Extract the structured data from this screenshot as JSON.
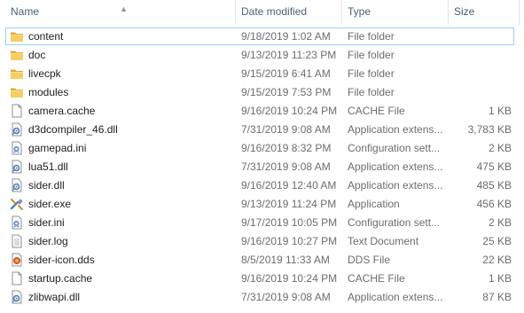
{
  "columns": {
    "name": "Name",
    "date_modified": "Date modified",
    "type": "Type",
    "size": "Size"
  },
  "sort": {
    "column": "name",
    "direction": "ascending"
  },
  "colors": {
    "header_text": "#4c607a",
    "selection_border": "#99d1ff",
    "folder": "#e8b64a",
    "meta_text": "#6d6d6d"
  },
  "files": [
    {
      "name": "content",
      "date": "9/18/2019 1:02 AM",
      "type": "File folder",
      "size": "",
      "icon": "folder-icon",
      "selected": true
    },
    {
      "name": "doc",
      "date": "9/13/2019 11:23 PM",
      "type": "File folder",
      "size": "",
      "icon": "folder-icon"
    },
    {
      "name": "livecpk",
      "date": "9/15/2019 6:41 AM",
      "type": "File folder",
      "size": "",
      "icon": "folder-icon"
    },
    {
      "name": "modules",
      "date": "9/15/2019 7:53 PM",
      "type": "File folder",
      "size": "",
      "icon": "folder-icon"
    },
    {
      "name": "camera.cache",
      "date": "9/16/2019 10:24 PM",
      "type": "CACHE File",
      "size": "1 KB",
      "icon": "blank-file-icon"
    },
    {
      "name": "d3dcompiler_46.dll",
      "date": "7/31/2019 9:08 AM",
      "type": "Application extens...",
      "size": "3,783 KB",
      "icon": "dll-file-icon"
    },
    {
      "name": "gamepad.ini",
      "date": "9/16/2019 8:32 PM",
      "type": "Configuration sett...",
      "size": "2 KB",
      "icon": "settings-file-icon"
    },
    {
      "name": "lua51.dll",
      "date": "7/31/2019 9:08 AM",
      "type": "Application extens...",
      "size": "475 KB",
      "icon": "dll-file-icon"
    },
    {
      "name": "sider.dll",
      "date": "9/16/2019 12:40 AM",
      "type": "Application extens...",
      "size": "485 KB",
      "icon": "dll-file-icon"
    },
    {
      "name": "sider.exe",
      "date": "9/13/2019 11:24 PM",
      "type": "Application",
      "size": "456 KB",
      "icon": "application-icon"
    },
    {
      "name": "sider.ini",
      "date": "9/17/2019 10:05 PM",
      "type": "Configuration sett...",
      "size": "2 KB",
      "icon": "settings-file-icon"
    },
    {
      "name": "sider.log",
      "date": "9/16/2019 10:27 PM",
      "type": "Text Document",
      "size": "25 KB",
      "icon": "text-file-icon"
    },
    {
      "name": "sider-icon.dds",
      "date": "8/5/2019 11:33 AM",
      "type": "DDS File",
      "size": "22 KB",
      "icon": "dds-file-icon"
    },
    {
      "name": "startup.cache",
      "date": "9/16/2019 10:24 PM",
      "type": "CACHE File",
      "size": "1 KB",
      "icon": "blank-file-icon"
    },
    {
      "name": "zlibwapi.dll",
      "date": "7/31/2019 9:08 AM",
      "type": "Application extens...",
      "size": "87 KB",
      "icon": "dll-file-icon"
    }
  ]
}
